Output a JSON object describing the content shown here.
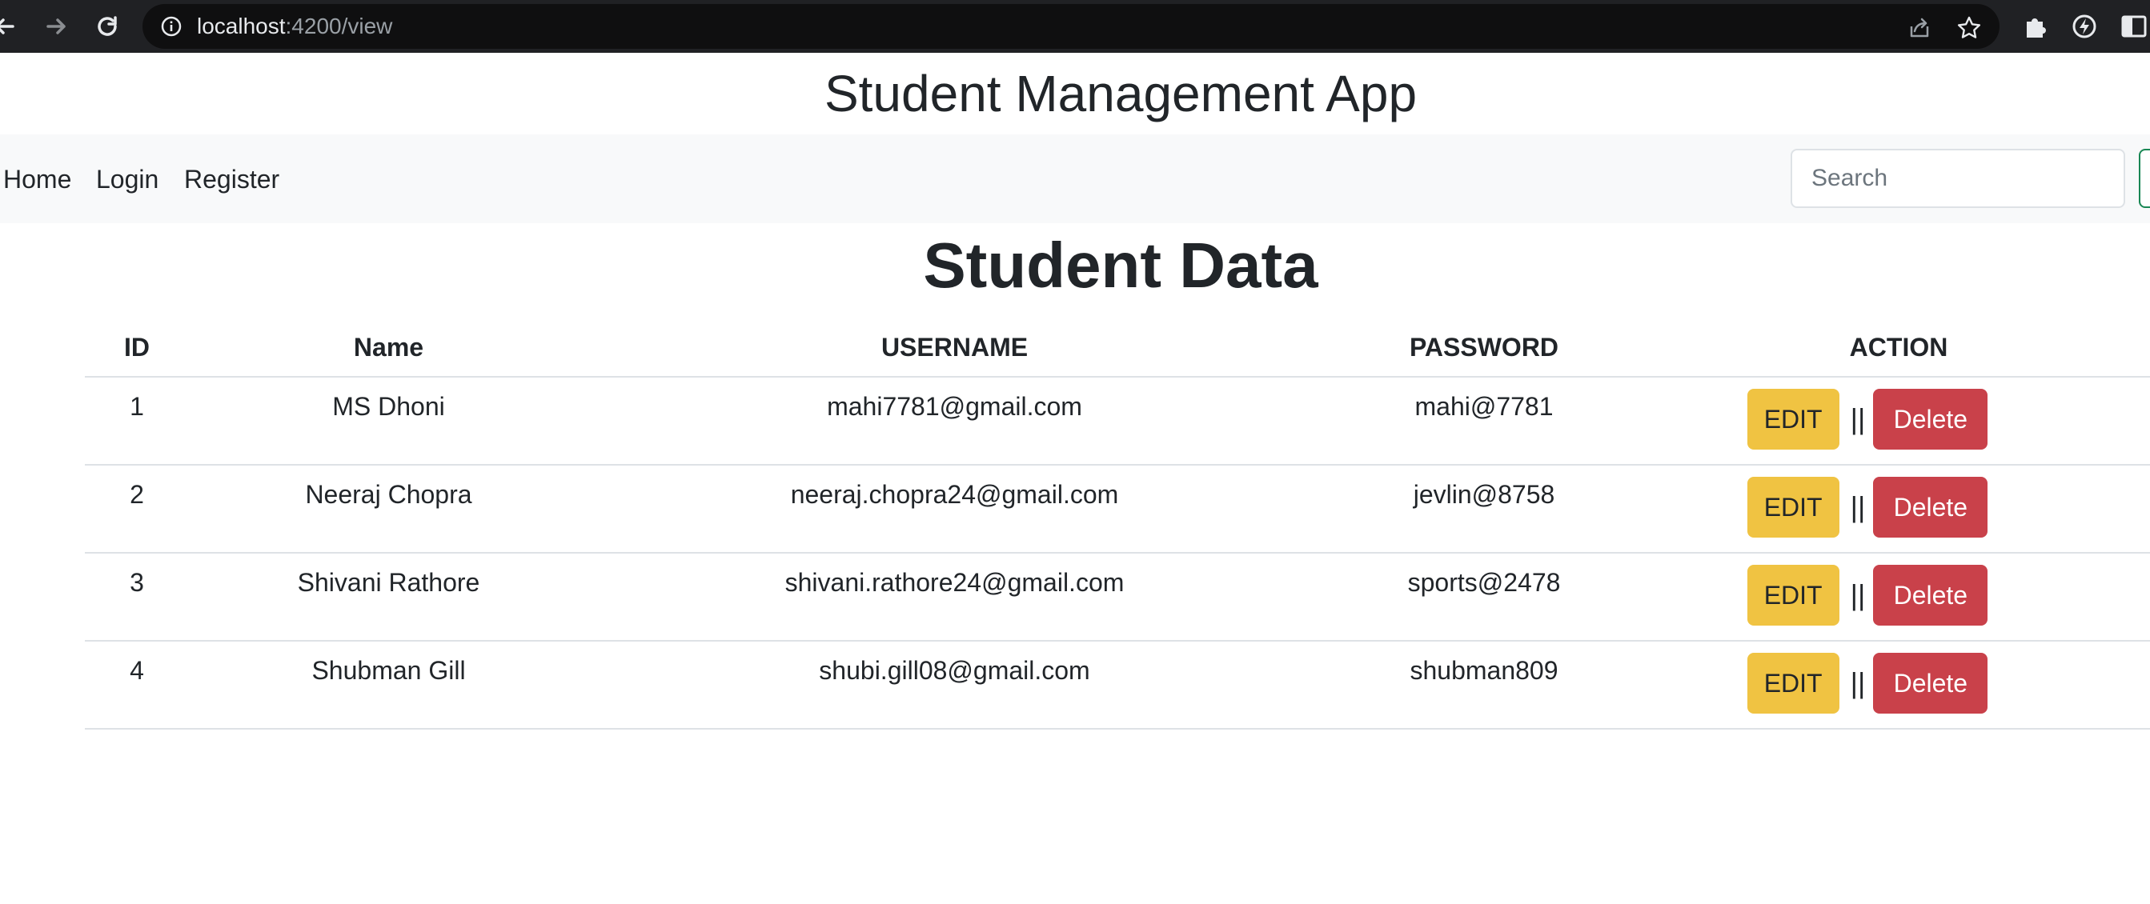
{
  "browser": {
    "url_host": "localhost",
    "url_rest": ":4200/view",
    "icons": [
      "back-arrow-icon",
      "forward-arrow-icon",
      "reload-icon",
      "info-icon",
      "share-icon",
      "bookmark-star-icon",
      "extensions-puzzle-icon",
      "extension-icon",
      "side-panel-icon"
    ]
  },
  "app": {
    "title": "Student Management App"
  },
  "navbar": {
    "links": [
      "Home",
      "Login",
      "Register"
    ],
    "search_placeholder": "Search"
  },
  "page": {
    "heading": "Student Data"
  },
  "table": {
    "headers": [
      "ID",
      "Name",
      "USERNAME",
      "PASSWORD",
      "ACTION"
    ],
    "rows": [
      {
        "id": "1",
        "name": "MS Dhoni",
        "username": "mahi7781@gmail.com",
        "password": "mahi@7781"
      },
      {
        "id": "2",
        "name": "Neeraj Chopra",
        "username": "neeraj.chopra24@gmail.com",
        "password": "jevlin@8758"
      },
      {
        "id": "3",
        "name": "Shivani Rathore",
        "username": "shivani.rathore24@gmail.com",
        "password": "sports@2478"
      },
      {
        "id": "4",
        "name": "Shubman Gill",
        "username": "shubi.gill08@gmail.com",
        "password": "shubman809"
      }
    ],
    "edit_label": "EDIT",
    "separator": "||",
    "delete_label": "Delete"
  },
  "colors": {
    "edit": "#f0c342",
    "delete": "#c9414a",
    "navbar_bg": "#f8f9fa",
    "search_button_border": "#198754"
  }
}
